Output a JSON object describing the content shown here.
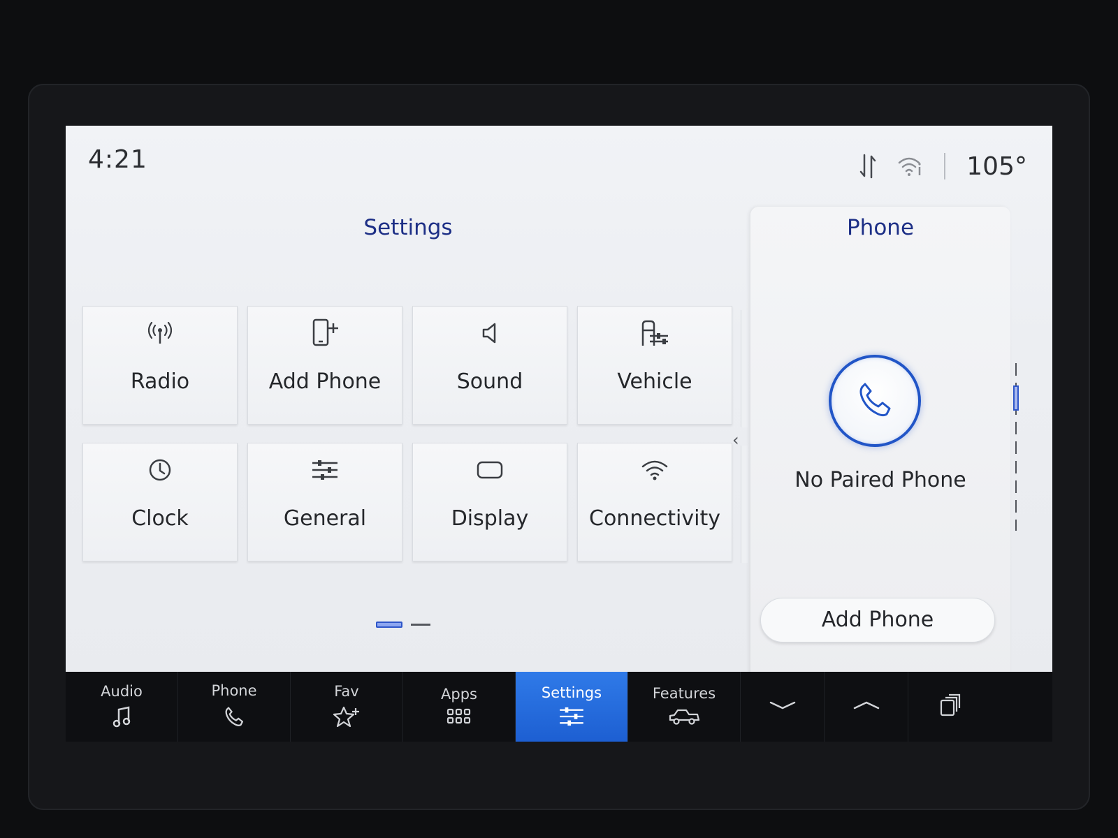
{
  "status": {
    "time": "4:21",
    "temperature": "105°"
  },
  "settings": {
    "title": "Settings",
    "tiles": [
      {
        "label": "Radio",
        "icon": "radio-antenna-icon"
      },
      {
        "label": "Add Phone",
        "icon": "add-phone-icon"
      },
      {
        "label": "Sound",
        "icon": "speaker-icon"
      },
      {
        "label": "Vehicle",
        "icon": "vehicle-settings-icon"
      },
      {
        "label": "Clock",
        "icon": "clock-icon"
      },
      {
        "label": "General",
        "icon": "sliders-icon"
      },
      {
        "label": "Display",
        "icon": "display-icon"
      },
      {
        "label": "Connectivity",
        "icon": "wifi-icon"
      }
    ]
  },
  "phone_panel": {
    "title": "Phone",
    "status": "No Paired Phone",
    "button": "Add Phone"
  },
  "dock": {
    "items": [
      {
        "label": "Audio",
        "icon": "music-note-icon"
      },
      {
        "label": "Phone",
        "icon": "phone-icon"
      },
      {
        "label": "Fav",
        "icon": "star-plus-icon"
      },
      {
        "label": "Apps",
        "icon": "apps-grid-icon"
      },
      {
        "label": "Settings",
        "icon": "sliders-icon",
        "active": true
      },
      {
        "label": "Features",
        "icon": "truck-icon"
      }
    ],
    "extra_icons": [
      "chevron-down-icon",
      "chevron-up-icon",
      "window-switch-icon"
    ]
  },
  "colors": {
    "accent": "#1d5fd2",
    "title": "#1d2f86"
  }
}
